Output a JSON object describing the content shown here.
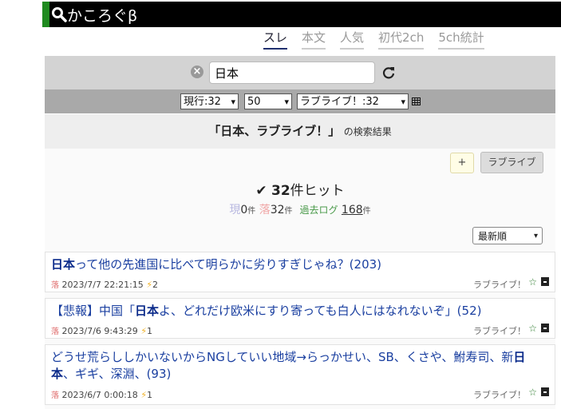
{
  "header": {
    "title": "かころぐβ"
  },
  "tabs": [
    {
      "label": "スレ",
      "active": true
    },
    {
      "label": "本文",
      "active": false
    },
    {
      "label": "人気",
      "active": false
    },
    {
      "label": "初代2ch",
      "active": false
    },
    {
      "label": "5ch統計",
      "active": false
    }
  ],
  "search": {
    "value": "日本"
  },
  "filters": {
    "mode": "現行:32",
    "limit": "50",
    "board": "ラブライブ！:32"
  },
  "result": {
    "query": "日本、ラブライブ！",
    "suffix": "の検索結果"
  },
  "buttons": {
    "plus": "+",
    "tag": "ラブライブ"
  },
  "hits": {
    "count": "32",
    "label": "件ヒット"
  },
  "counts": {
    "current_label": "現",
    "current": "0",
    "unit": "件",
    "fallen_label": "落",
    "fallen": "32",
    "archive_label": "過去ログ",
    "archive": "168"
  },
  "sort": {
    "value": "最新順"
  },
  "threads": [
    {
      "title_hl": "日本",
      "title_rest": "って他の先進国に比べて明らかに劣りすぎじゃね？(203)",
      "status": "落",
      "date": "2023/7/7 22:21:15",
      "bolt": "⚡",
      "speed": "2",
      "board": "ラブライブ！"
    },
    {
      "title_pre": "【悲報】中国「",
      "title_hl": "日本",
      "title_rest": "よ、どれだけ欧米にすり寄っても白人にはなれないぞ」(52)",
      "status": "落",
      "date": "2023/7/6 9:43:29",
      "bolt": "⚡",
      "speed": "1",
      "board": "ラブライブ！"
    },
    {
      "title_pre": "どうせ荒らししかいないからNGしていい地域→らっかせい、SB、くさや、鮒寿司、新",
      "title_hl": "日本",
      "title_rest": "、ギギ、深淵、(93)",
      "status": "落",
      "date": "2023/6/7 0:00:18",
      "bolt": "⚡",
      "speed": "1",
      "board": "ラブライブ！"
    }
  ]
}
